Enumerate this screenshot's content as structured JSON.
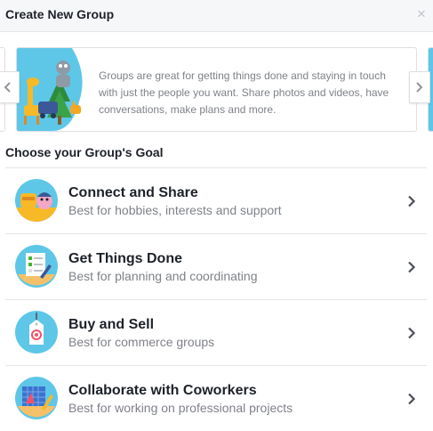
{
  "dialog": {
    "title": "Create New Group",
    "close_label": "×"
  },
  "intro_card": {
    "text": "Groups are great for getting things done and staying in touch with just the people you want. Share photos and videos, have conversations, make plans and more."
  },
  "goal_section": {
    "title": "Choose your Group's Goal",
    "items": [
      {
        "title": "Connect and Share",
        "description": "Best for hobbies, interests and support",
        "icon": "friends-icon"
      },
      {
        "title": "Get Things Done",
        "description": "Best for planning and coordinating",
        "icon": "checklist-icon"
      },
      {
        "title": "Buy and Sell",
        "description": "Best for commerce groups",
        "icon": "price-tag-icon"
      },
      {
        "title": "Collaborate with Coworkers",
        "description": "Best for working on professional projects",
        "icon": "blueprint-icon"
      }
    ]
  },
  "colors": {
    "header_bg": "#f6f7f9",
    "title_text": "#1d2129",
    "secondary_text": "#7f8289",
    "icon_circle": "#5ec7e8",
    "divider": "#e5e5e5"
  }
}
